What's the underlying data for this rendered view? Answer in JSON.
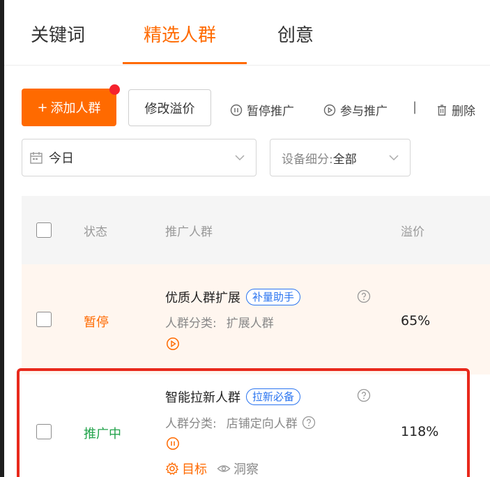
{
  "tabs": [
    {
      "label": "关键词"
    },
    {
      "label": "精选人群"
    },
    {
      "label": "创意"
    }
  ],
  "toolbar": {
    "add_label": "添加人群",
    "add_plus": "+",
    "bid_label": "修改溢价",
    "pause_label": "暂停推广",
    "join_label": "参与推广",
    "separator": "|",
    "delete_label": "删除"
  },
  "filters": {
    "date_value": "今日",
    "device_label": "设备细分:",
    "device_value": "全部"
  },
  "table": {
    "headers": {
      "status": "状态",
      "crowd": "推广人群",
      "premium": "溢价"
    },
    "rows": [
      {
        "status": "暂停",
        "name": "优质人群扩展",
        "tag": "补量助手",
        "category_label": "人群分类:",
        "category_value": "扩展人群",
        "premium": "65%"
      },
      {
        "status": "推广中",
        "name": "智能拉新人群",
        "tag": "拉新必备",
        "category_label": "人群分类:",
        "category_value": "店铺定向人群",
        "premium": "118%",
        "target_label": "目标",
        "insight_label": "洞察"
      }
    ]
  },
  "colors": {
    "accent": "#ff6a00",
    "active": "#22a34b",
    "tag_blue": "#2a74f0",
    "highlight": "#e8291c"
  }
}
